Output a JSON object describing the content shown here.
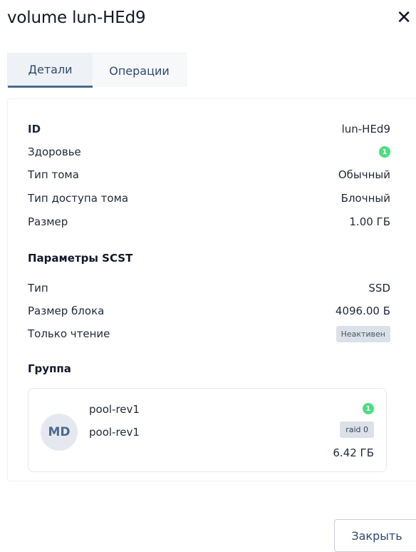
{
  "dialog": {
    "title": "volume lun-HEd9",
    "close_glyph": "✕"
  },
  "tabs": [
    {
      "label": "Детали",
      "active": true
    },
    {
      "label": "Операции",
      "active": false
    }
  ],
  "details": {
    "id_label": "ID",
    "id_value": "lun-HEd9",
    "health_label": "Здоровье",
    "health_value": "1",
    "volume_type_label": "Тип тома",
    "volume_type_value": "Обычный",
    "access_type_label": "Тип доступа тома",
    "access_type_value": "Блочный",
    "size_label": "Размер",
    "size_value": "1.00 ГБ"
  },
  "scst": {
    "title": "Параметры SCST",
    "type_label": "Тип",
    "type_value": "SSD",
    "block_size_label": "Размер блока",
    "block_size_value": "4096.00 Б",
    "readonly_label": "Только чтение",
    "readonly_value": "Неактивен"
  },
  "group": {
    "title": "Группа",
    "avatar": "MD",
    "name": "pool-rev1",
    "subname": "pool-rev1",
    "health": "1",
    "raid": "raid 0",
    "size": "6.42 ГБ"
  },
  "footer": {
    "close_label": "Закрыть"
  },
  "colors": {
    "health_green": "#4ade80",
    "accent": "#4a6a8e",
    "badge_bg": "#dbe1e8"
  }
}
